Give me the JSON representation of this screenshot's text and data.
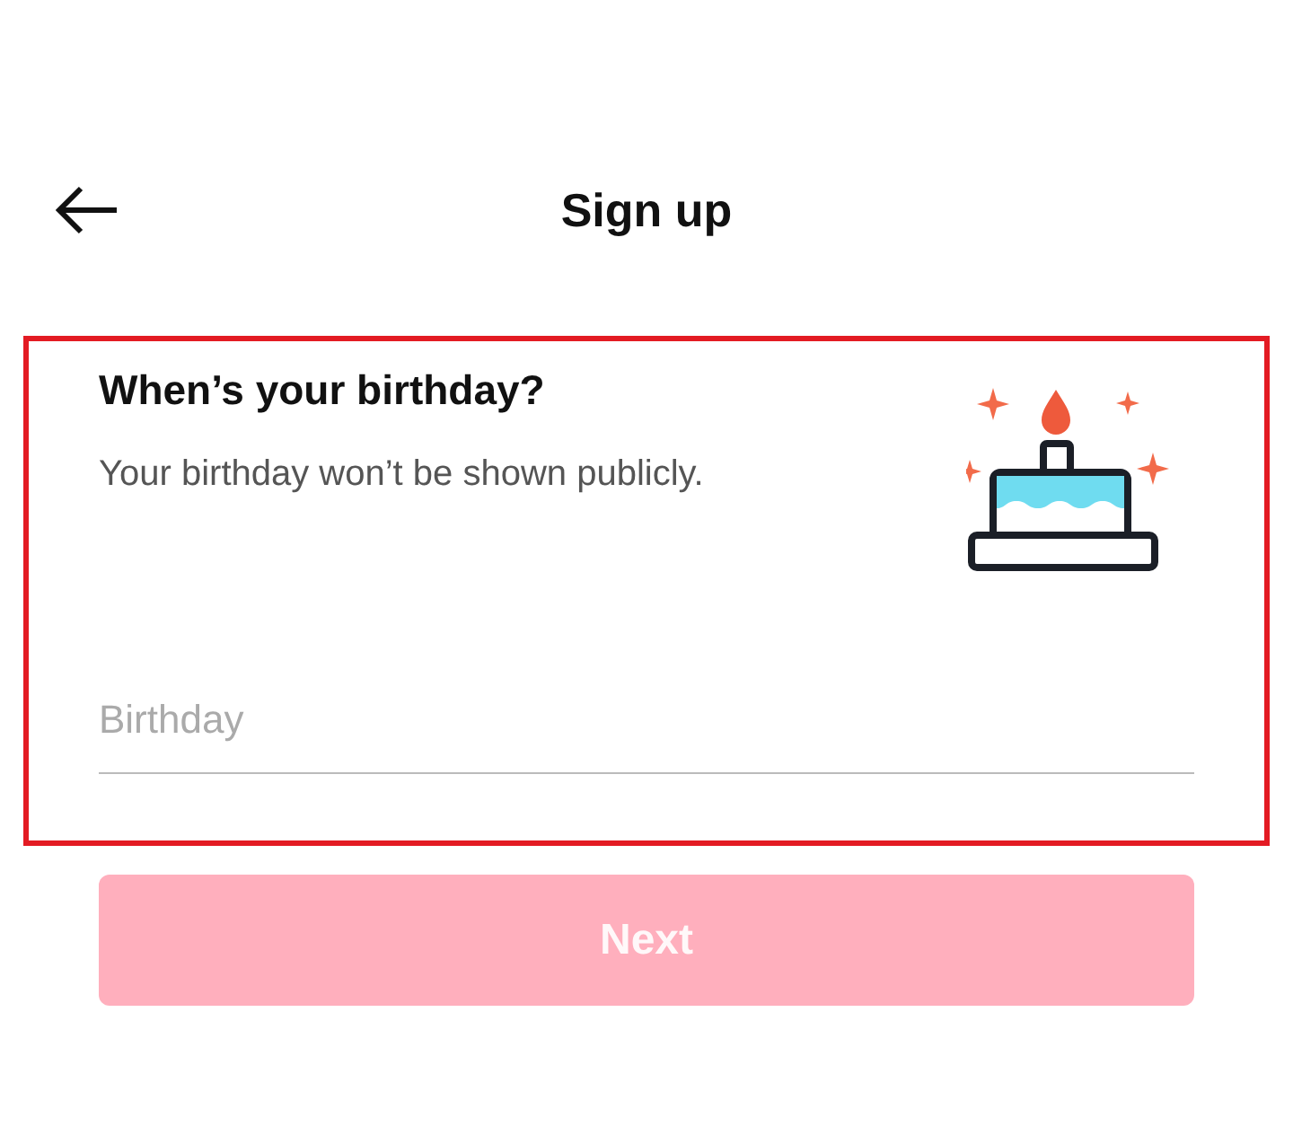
{
  "header": {
    "title": "Sign up"
  },
  "birthday_section": {
    "highlighted": true,
    "heading": "When’s your birthday?",
    "subtitle": "Your birthday won’t be shown publicly.",
    "field": {
      "placeholder": "Birthday"
    }
  },
  "next_button": {
    "label": "Next",
    "disabled": true
  }
}
